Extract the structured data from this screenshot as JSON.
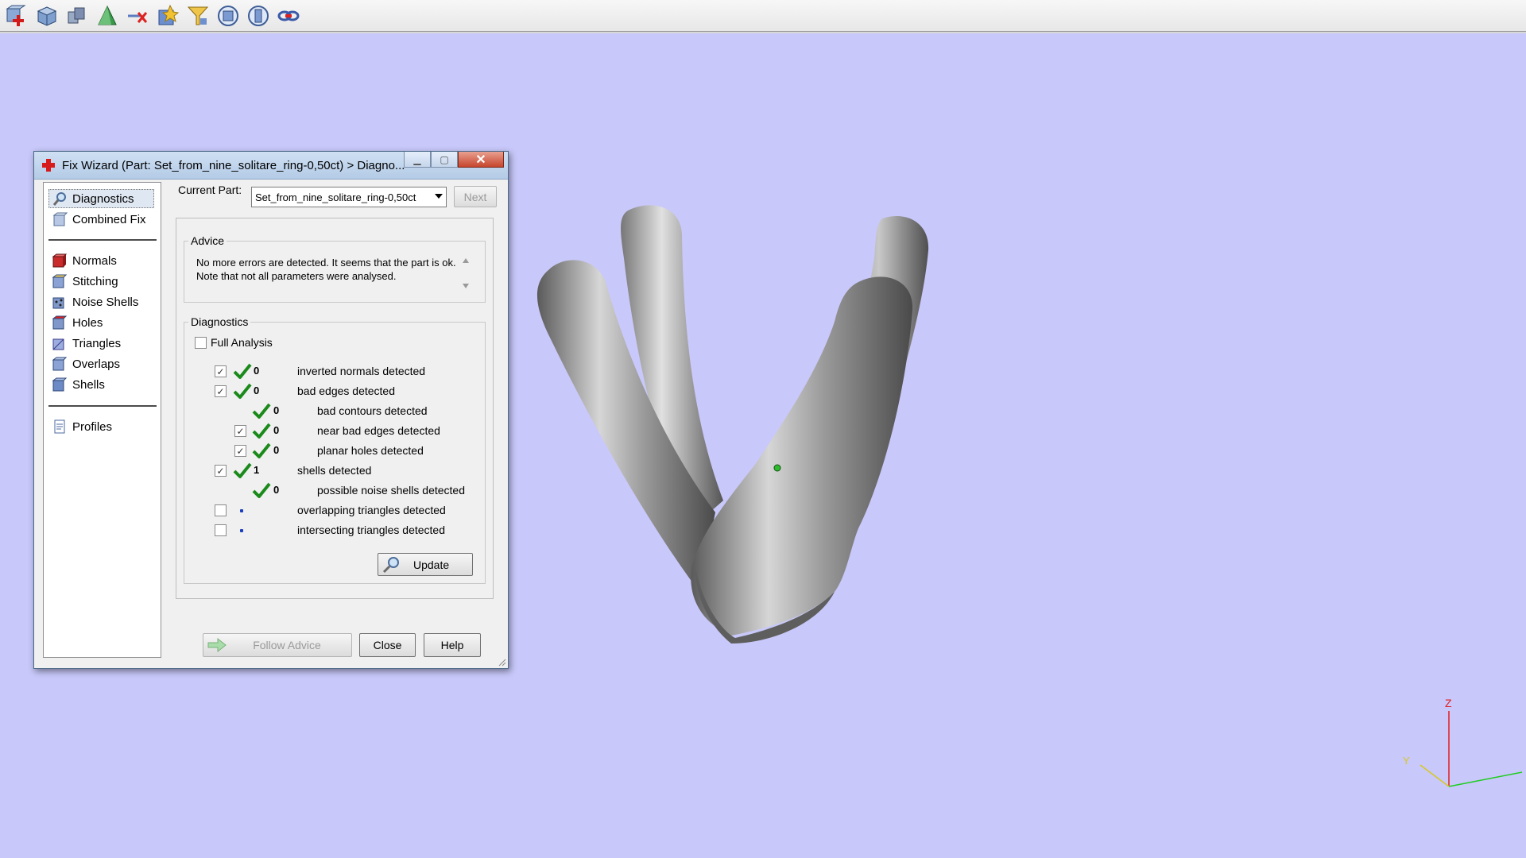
{
  "toolbar": {
    "icons": [
      "add-part-icon",
      "part-box-icon",
      "multi-part-icon",
      "shell-icon",
      "remove-icon",
      "fix-wizard-icon",
      "filter-icon",
      "view-front-icon",
      "view-side-icon",
      "link-icon"
    ]
  },
  "dialog": {
    "title": "Fix Wizard (Part: Set_from_nine_solitare_ring-0,50ct) > Diagno...",
    "nav": {
      "items": [
        {
          "label": "Diagnostics",
          "icon": "magnifier-icon",
          "selected": true
        },
        {
          "label": "Combined Fix",
          "icon": "combined-fix-icon"
        },
        {
          "label": "Normals",
          "icon": "normals-cube-icon"
        },
        {
          "label": "Stitching",
          "icon": "stitching-cube-icon"
        },
        {
          "label": "Noise Shells",
          "icon": "noise-shells-icon"
        },
        {
          "label": "Holes",
          "icon": "holes-cube-icon"
        },
        {
          "label": "Triangles",
          "icon": "triangles-cube-icon"
        },
        {
          "label": "Overlaps",
          "icon": "overlaps-cube-icon"
        },
        {
          "label": "Shells",
          "icon": "shells-cube-icon"
        },
        {
          "label": "Profiles",
          "icon": "profiles-doc-icon"
        }
      ]
    },
    "current_part_label": "Current Part:",
    "current_part_value": "Set_from_nine_solitare_ring-0,50ct",
    "next_label": "Next",
    "advice": {
      "title": "Advice",
      "text": "No more errors are detected. It seems that the part is ok. Note that not all parameters were analysed."
    },
    "diagnostics": {
      "title": "Diagnostics",
      "full_analysis_label": "Full Analysis",
      "full_analysis_checked": false,
      "rows": [
        {
          "checkbox": true,
          "checked": true,
          "status": "ok",
          "count": "0",
          "label": "inverted normals detected",
          "indent": 0
        },
        {
          "checkbox": true,
          "checked": true,
          "status": "ok",
          "count": "0",
          "label": "bad edges detected",
          "indent": 0
        },
        {
          "checkbox": false,
          "checked": false,
          "status": "ok",
          "count": "0",
          "label": "bad contours detected",
          "indent": 1
        },
        {
          "checkbox": true,
          "checked": true,
          "status": "ok",
          "count": "0",
          "label": "near bad edges detected",
          "indent": 1
        },
        {
          "checkbox": true,
          "checked": true,
          "status": "ok",
          "count": "0",
          "label": "planar holes detected",
          "indent": 1
        },
        {
          "checkbox": true,
          "checked": true,
          "status": "ok",
          "count": "1",
          "label": "shells detected",
          "indent": 0
        },
        {
          "checkbox": false,
          "checked": false,
          "status": "ok",
          "count": "0",
          "label": "possible noise shells detected",
          "indent": 1
        },
        {
          "checkbox": true,
          "checked": false,
          "status": "none",
          "count": "",
          "label": "overlapping triangles detected",
          "indent": 0
        },
        {
          "checkbox": true,
          "checked": false,
          "status": "none",
          "count": "",
          "label": "intersecting triangles detected",
          "indent": 0
        }
      ],
      "update_label": "Update"
    },
    "follow_advice_label": "Follow Advice",
    "close_label": "Close",
    "help_label": "Help"
  },
  "viewport": {
    "background_color": "#c8c8fa",
    "axis_label_z": "Z",
    "axis_label_y": "Y"
  }
}
